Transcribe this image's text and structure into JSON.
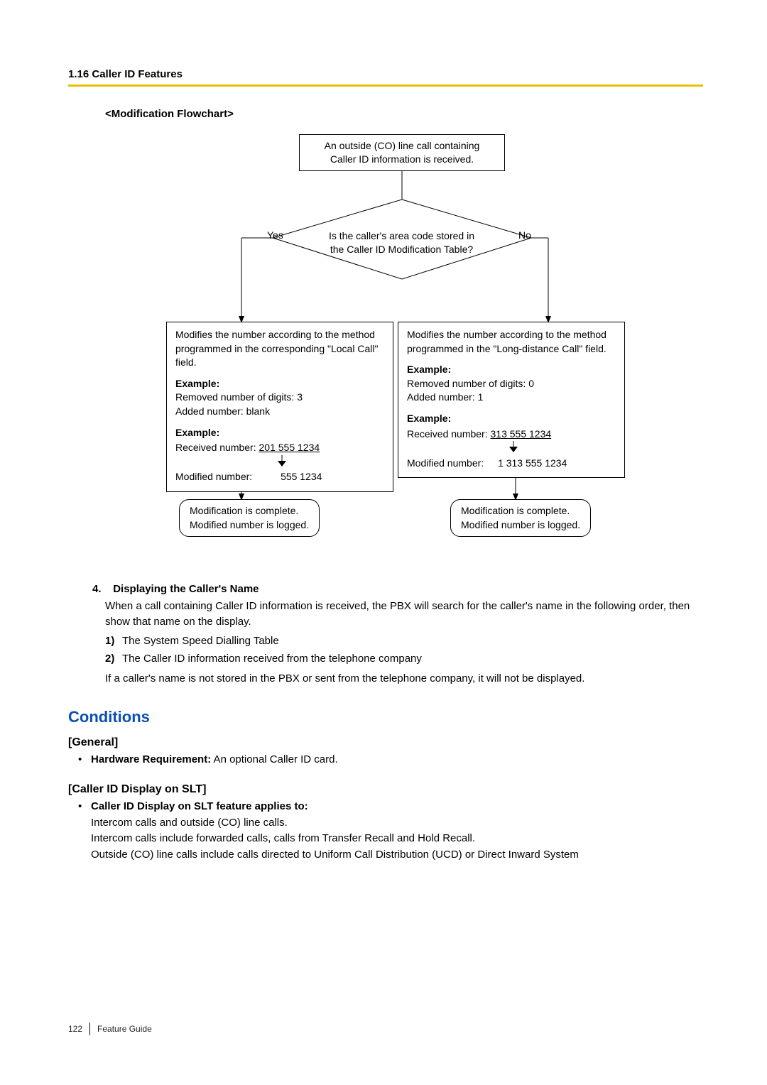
{
  "header": {
    "section": "1.16 Caller ID Features"
  },
  "flow": {
    "title": "<Modification Flowchart>",
    "start": {
      "l1": "An outside (CO) line call containing",
      "l2": "Caller ID information is received."
    },
    "decision": {
      "l1": "Is the caller's area code stored in",
      "l2": "the Caller ID Modification Table?"
    },
    "yes": "Yes",
    "no": "No",
    "left": {
      "para1": "Modifies the number according to the method programmed in the corresponding \"Local Call\" field.",
      "eg1label": "Example:",
      "eg1a": "Removed number of digits: 3",
      "eg1b": "Added number: blank",
      "eg2label": "Example:",
      "eg2a_pre": "Received number: ",
      "eg2a_num": "201 555 1234",
      "modlabel": "Modified number:",
      "modval": "555 1234"
    },
    "right": {
      "para1": "Modifies the number according to the method programmed in the \"Long-distance Call\" field.",
      "eg1label": "Example:",
      "eg1a": "Removed number of digits: 0",
      "eg1b": "Added number: 1",
      "eg2label": "Example:",
      "eg2a_pre": "Received number: ",
      "eg2a_num": "313 555 1234",
      "modlabel": "Modified number:",
      "modval": "1  313 555 1234"
    },
    "end": {
      "l1": "Modification is complete.",
      "l2": "Modified number is logged."
    }
  },
  "section4": {
    "num": "4.",
    "title": "Displaying the Caller's Name",
    "para": "When a call containing Caller ID information is received, the PBX will search for the caller's name in the following order, then show that name on the display.",
    "o1": "The System Speed Dialling Table",
    "o2": "The Caller ID information received from the telephone company",
    "para2": "If a caller's name is not stored in the PBX or sent from the telephone company, it will not be displayed."
  },
  "conditions": {
    "heading": "Conditions",
    "general": {
      "head": "[General]",
      "b1_label": "Hardware Requirement:",
      "b1_text": " An optional Caller ID card."
    },
    "slt": {
      "head": "[Caller ID Display on SLT]",
      "b1_label": "Caller ID Display on SLT feature applies to:",
      "b1_l1": "Intercom calls and outside (CO) line calls.",
      "b1_l2": "Intercom calls include forwarded calls, calls from Transfer Recall and Hold Recall.",
      "b1_l3": "Outside (CO) line calls include calls directed to Uniform Call Distribution (UCD) or Direct Inward System"
    }
  },
  "footer": {
    "page": "122",
    "guide": "Feature Guide"
  }
}
